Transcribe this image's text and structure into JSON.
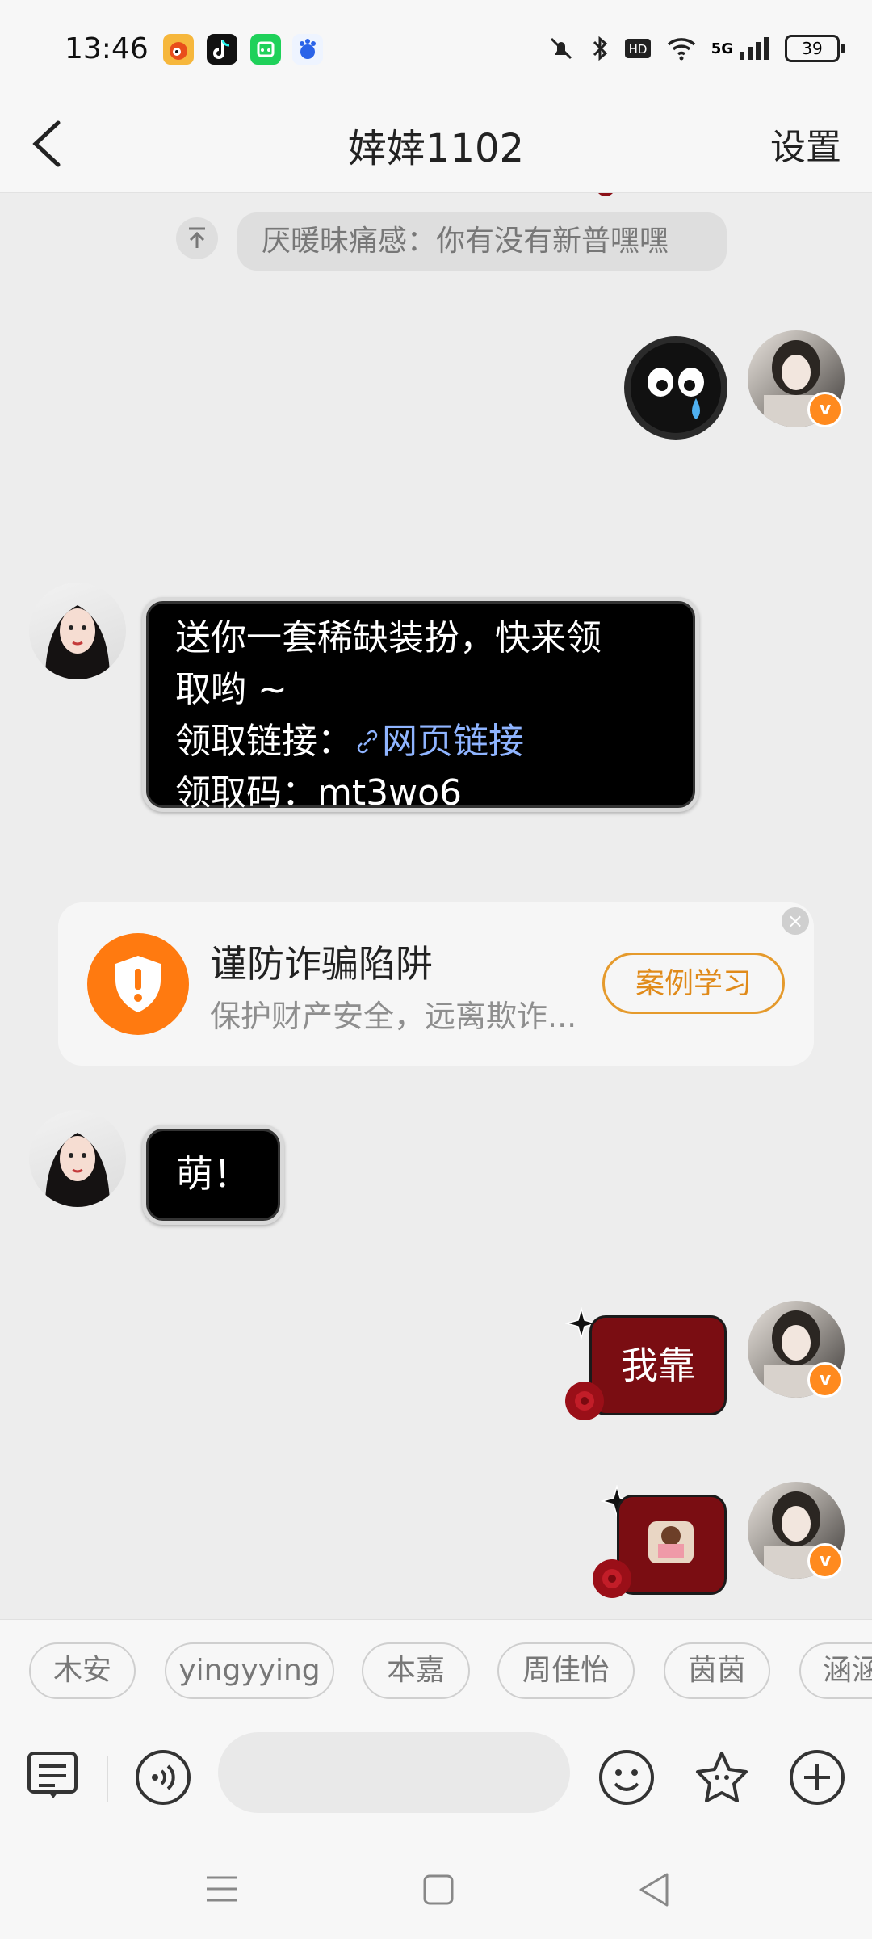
{
  "status_bar": {
    "time": "13:46",
    "apps": [
      "weibo-icon",
      "tiktok-icon",
      "app-green-icon",
      "baidu-icon"
    ],
    "indicators": [
      "mute-icon",
      "bluetooth-icon",
      "hd-icon",
      "wifi-icon",
      "5g-signal-icon"
    ],
    "network": "5G",
    "battery": "39"
  },
  "header": {
    "title": "婞婞1102",
    "settings_label": "设置"
  },
  "pinned_message": {
    "text": "厌暖昧痛感：你有没有新普嘿嘿"
  },
  "messages": [
    {
      "side": "right",
      "type": "sticker",
      "sticker": "crying-face-sticker"
    },
    {
      "side": "left",
      "type": "text",
      "lines": [
        "送你一套稀缺装扮，快来领",
        "取哟 ~"
      ],
      "link_prefix": "领取链接：",
      "link_text": "网页链接",
      "code_line": "领取码：mt3wo6"
    },
    {
      "side": "left",
      "type": "text",
      "text": "萌！"
    },
    {
      "side": "right",
      "type": "text",
      "text": "我靠"
    },
    {
      "side": "right",
      "type": "sticker",
      "sticker": "small-sticker"
    }
  ],
  "fraud_card": {
    "title": "谨防诈骗陷阱",
    "desc": "保护财产安全，远离欺诈...",
    "button": "案例学习",
    "accent": "#ff7a10"
  },
  "quick_replies": [
    "木安",
    "yingyying",
    "本嘉",
    "周佳怡",
    "茵茵",
    "涵涵"
  ],
  "input_bar": {
    "placeholder": ""
  },
  "colors": {
    "background": "#ededed",
    "bubble": "#000000",
    "link": "#8fb4ff",
    "badge": "#ff8a1e"
  }
}
